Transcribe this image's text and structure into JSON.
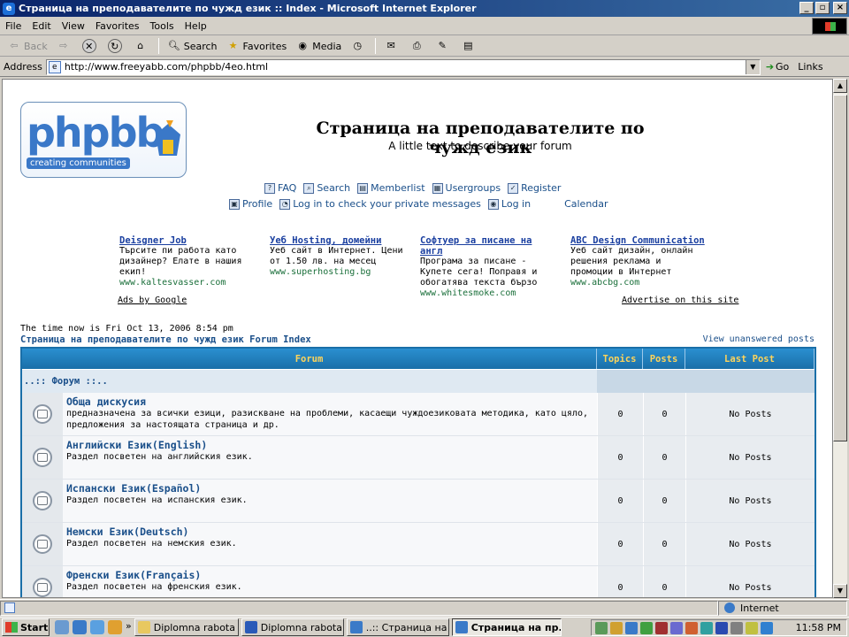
{
  "window": {
    "title": "Страница на преподавателите по чужд език :: Index - Microsoft Internet Explorer",
    "minimize": "_",
    "maximize": "▫",
    "close": "×"
  },
  "menu": [
    "File",
    "Edit",
    "View",
    "Favorites",
    "Tools",
    "Help"
  ],
  "toolbar": {
    "back": "Back",
    "search": "Search",
    "favorites": "Favorites",
    "media": "Media"
  },
  "address": {
    "label": "Address",
    "url": "http://www.freeyabb.com/phpbb/4eo.html",
    "go": "Go",
    "links": "Links"
  },
  "page": {
    "logo_word": "phpbb",
    "logo_tag": "creating communities",
    "site_title": "Страница на преподавателите по чужд език",
    "site_desc": "A little text to describe your forum",
    "nav1": [
      "FAQ",
      "Search",
      "Memberlist",
      "Usergroups",
      "Register"
    ],
    "nav2": [
      "Profile",
      "Log in to check your private messages",
      "Log in",
      "Calendar"
    ],
    "ads": [
      {
        "title": "Deisgner Job",
        "text": "Търсите пи работа като дизайнер? Елате в нашия екип!",
        "url": "www.kaltesvasser.com"
      },
      {
        "title": "Уеб Hosting, домейни",
        "text": "Уеб сайт в Интернет. Цени от 1.50 лв. на месец",
        "url": "www.superhosting.bg"
      },
      {
        "title": "Софтуер за писане на англ",
        "text": "Програма за писане - Купете сега! Поправя и обогатява текста бързо",
        "url": "www.whitesmoke.com"
      },
      {
        "title": "ABC Design Communication",
        "text": "Уеб сайт дизайн, онлайн решения реклама и промоции в Интернет",
        "url": "www.abcbg.com"
      }
    ],
    "ads_by_google": "Ads by Google",
    "advertise": "Advertise on this site",
    "time_now": "The time now is Fri Oct 13, 2006 8:54 pm",
    "forum_index": "Страница на преподавателите по чужд език Forum Index",
    "unanswered": "View unanswered posts"
  },
  "table": {
    "headers": {
      "forum": "Forum",
      "topics": "Topics",
      "posts": "Posts",
      "last": "Last Post"
    },
    "category": "..:: Форум ::..",
    "rows": [
      {
        "name": "Обща дискусия",
        "desc": "предназначена за всички езици, разискване на проблеми, касаещи чуждоезиковата методика, като цяло, предложения за настоящата страница и др.",
        "topics": "0",
        "posts": "0",
        "last": "No Posts"
      },
      {
        "name": "Английски Език(English)",
        "desc": "Раздел посветен на английския език.",
        "topics": "0",
        "posts": "0",
        "last": "No Posts"
      },
      {
        "name": "Испански Език(Español)",
        "desc": "Раздел посветен на испанския език.",
        "topics": "0",
        "posts": "0",
        "last": "No Posts"
      },
      {
        "name": "Немски Език(Deutsch)",
        "desc": "Раздел посветен на немския език.",
        "topics": "0",
        "posts": "0",
        "last": "No Posts"
      },
      {
        "name": "Френски Език(Français)",
        "desc": "Раздел посветен на френския език.",
        "topics": "0",
        "posts": "0",
        "last": "No Posts"
      }
    ]
  },
  "status": {
    "zone": "Internet"
  },
  "taskbar": {
    "start": "Start",
    "chevron": "»",
    "tasks": [
      "Diplomna rabota",
      "Diplomna rabota.d...",
      "..:: Страница на ...",
      "Страница на пр..."
    ],
    "clock": "11:58 PM"
  }
}
